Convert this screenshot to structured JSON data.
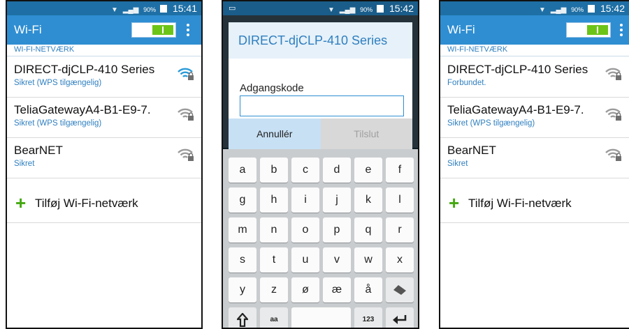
{
  "status_left": {
    "time": "15:41",
    "battery": "90%"
  },
  "status_mid": {
    "time": "15:42",
    "battery": "90%"
  },
  "status_right": {
    "time": "15:42",
    "battery": "90%"
  },
  "actionbar": {
    "title": "Wi-Fi"
  },
  "section_header": "WI-FI-NETVÆRK",
  "networks_left": [
    {
      "name": "DIRECT-djCLP-410 Series",
      "status": "Sikret (WPS tilgængelig)",
      "signal_color": "#2a9bd8"
    },
    {
      "name": "TeliaGatewayA4-B1-E9-7.",
      "status": "Sikret (WPS tilgængelig)",
      "signal_color": "#9b9b9b"
    },
    {
      "name": "BearNET",
      "status": "Sikret",
      "signal_color": "#9b9b9b"
    }
  ],
  "networks_right": [
    {
      "name": "DIRECT-djCLP-410 Series",
      "status": "Forbundet.",
      "signal_color": "#9b9b9b"
    },
    {
      "name": "TeliaGatewayA4-B1-E9-7.",
      "status": "Sikret (WPS tilgængelig)",
      "signal_color": "#9b9b9b"
    },
    {
      "name": "BearNET",
      "status": "Sikret",
      "signal_color": "#9b9b9b"
    }
  ],
  "add_network": "Tilføj Wi-Fi-netværk",
  "dialog": {
    "title": "DIRECT-djCLP-410 Series",
    "field_label": "Adgangskode",
    "field_value": "",
    "cancel": "Annullér",
    "connect": "Tilslut"
  },
  "keyboard": {
    "row1": [
      "a",
      "b",
      "c",
      "d",
      "e",
      "f"
    ],
    "row2": [
      "g",
      "h",
      "i",
      "j",
      "k",
      "l"
    ],
    "row3": [
      "m",
      "n",
      "o",
      "p",
      "q",
      "r"
    ],
    "row4": [
      "s",
      "t",
      "u",
      "v",
      "w",
      "x"
    ],
    "row5": [
      "y",
      "z",
      "ø",
      "æ",
      "å"
    ],
    "row6": {
      "case": "aa",
      "numbers": "123"
    }
  }
}
